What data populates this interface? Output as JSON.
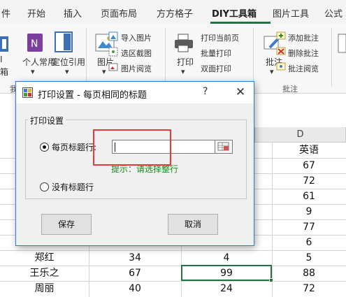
{
  "ribbon": {
    "tabs": [
      "件",
      "开始",
      "插入",
      "页面布局",
      "方方格子",
      "DIY工具箱",
      "图片工具",
      "公式"
    ],
    "active_tab": "DIY工具箱",
    "left_partial": {
      "top": "I",
      "bottom": "箱"
    },
    "groups": {
      "insert_group": {
        "personal_label": "个人常用",
        "locate_label": "定位引用"
      },
      "image_group": {
        "picture_label": "图片",
        "items": [
          "导入图片",
          "选区截图",
          "图片阅览"
        ]
      },
      "print_group": {
        "print_label": "打印",
        "items": [
          "打印当前页",
          "批量打印",
          "双面打印"
        ]
      },
      "comment_group": {
        "comment_label": "批注",
        "items": [
          "添加批注",
          "删除批注",
          "批注阅览"
        ],
        "group_label": "批注"
      },
      "partial_group_label": "我"
    },
    "accent_color": "#217346"
  },
  "sheet": {
    "column_d_header": "D",
    "rows": [
      {
        "a": "",
        "b": "",
        "c": "",
        "d": "英语"
      },
      {
        "a": "",
        "b": "",
        "c": "",
        "d": "67"
      },
      {
        "a": "",
        "b": "",
        "c": "",
        "d": "72"
      },
      {
        "a": "",
        "b": "",
        "c": "",
        "d": "61"
      },
      {
        "a": "",
        "b": "",
        "c": "",
        "d": "9"
      },
      {
        "a": "",
        "b": "",
        "c": "",
        "d": "77"
      },
      {
        "a": "",
        "b": "",
        "c": "",
        "d": "6"
      },
      {
        "a": "郑红",
        "b": "34",
        "c": "4",
        "d": "5"
      },
      {
        "a": "王乐之",
        "b": "67",
        "c": "99",
        "d": "88"
      },
      {
        "a": "周丽",
        "b": "40",
        "c": "24",
        "d": "72"
      }
    ]
  },
  "dialog": {
    "title": "打印设置 - 每页相同的标题",
    "help": "?",
    "close": "✕",
    "group_title": "打印设置",
    "option_title_row": "每页标题行:",
    "option_no_title": "没有标题行",
    "input_value": "",
    "hint": "提示：请选择整行",
    "save_label": "保存",
    "cancel_label": "取消",
    "highlight_color": "#e23b3b"
  }
}
